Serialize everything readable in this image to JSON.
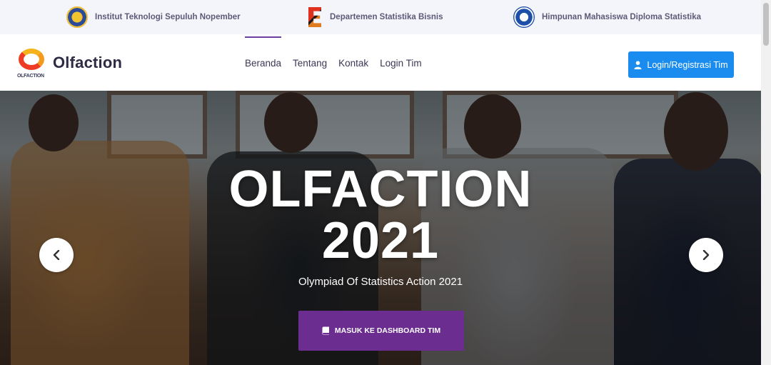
{
  "topbar": {
    "items": [
      {
        "label": "Institut Teknologi Sepuluh Nopember",
        "icon": "its-logo"
      },
      {
        "label": "Departemen Statistika Bisnis",
        "icon": "departemen-logo"
      },
      {
        "label": "Himpunan Mahasiswa Diploma Statistika",
        "icon": "himpunan-logo"
      }
    ]
  },
  "navbar": {
    "brand_name": "Olfaction",
    "brand_sub": "OLFACTION",
    "links": [
      "Beranda",
      "Tentang",
      "Kontak",
      "Login Tim"
    ],
    "active_link": "Beranda",
    "login_button": "Login/Registrasi Tim"
  },
  "hero": {
    "title_line1": "OLFACTION",
    "title_line2": "2021",
    "subtitle": "Olympiad Of Statistics Action 2021",
    "dashboard_button": "MASUK KE DASHBOARD TIM",
    "prev_icon": "chevron-left",
    "next_icon": "chevron-right"
  },
  "colors": {
    "primary_blue": "#1a8cf0",
    "purple": "#6c2d91",
    "nav_active": "#6b3fa0"
  }
}
